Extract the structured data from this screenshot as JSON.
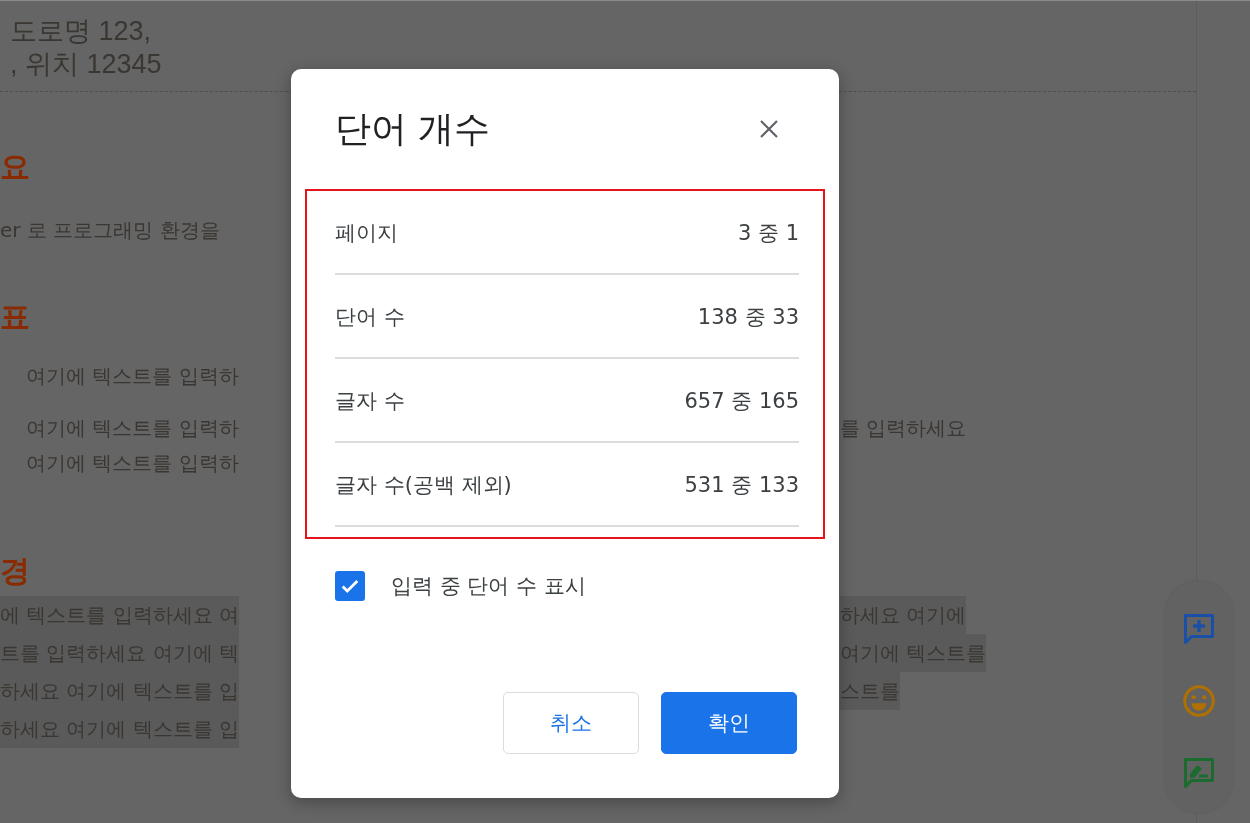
{
  "document": {
    "address_lines": [
      "도로명 123,",
      ", 위치 12345"
    ],
    "blocks": [
      {
        "kind": "heading",
        "left": "요"
      },
      {
        "kind": "paragraph",
        "left": "er 로 프로그래밍 환경을"
      },
      {
        "kind": "heading",
        "left": "표"
      },
      {
        "kind": "list_item",
        "left": "여기에 텍스트를 입력하"
      },
      {
        "kind": "list_item",
        "left": "여기에 텍스트를 입력하",
        "right": "를 입력하세요"
      },
      {
        "kind": "list_cont",
        "left": "여기에 텍스트를 입력하"
      },
      {
        "kind": "heading",
        "left": "경"
      },
      {
        "kind": "highlighted",
        "left": "에 텍스트를 입력하세요 여",
        "right": "하세요 여기에"
      },
      {
        "kind": "highlighted",
        "left": "트를 입력하세요 여기에 텍",
        "right": "여기에 텍스트를"
      },
      {
        "kind": "highlighted",
        "left": "하세요 여기에 텍스트를 입",
        "right": "스트를"
      },
      {
        "kind": "highlighted",
        "left": "하세요 여기에 텍스트를 입"
      }
    ]
  },
  "dialog": {
    "title": "단어 개수",
    "stats": [
      {
        "label": "페이지",
        "value": "3 중 1"
      },
      {
        "label": "단어 수",
        "value": "138 중 33"
      },
      {
        "label": "글자 수",
        "value": "657 중 165"
      },
      {
        "label": "글자 수(공백 제외)",
        "value": "531 중 133"
      }
    ],
    "checkbox": {
      "label": "입력 중 단어 수 표시",
      "checked": true
    },
    "buttons": [
      {
        "label": "취소",
        "kind": "secondary"
      },
      {
        "label": "확인",
        "kind": "primary"
      }
    ]
  }
}
